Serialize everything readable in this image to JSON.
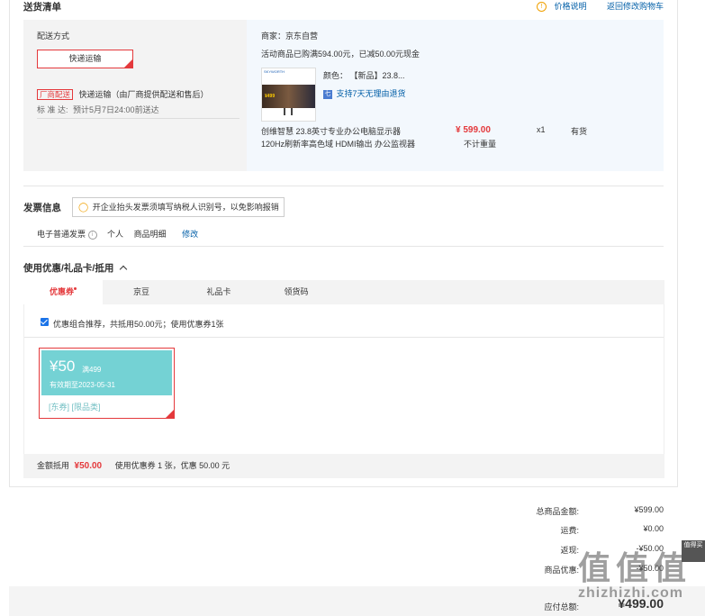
{
  "header": {
    "title": "送货清单",
    "price_note": "价格说明",
    "back_link": "返回修改购物车"
  },
  "shipping": {
    "label": "配送方式",
    "method_button": "快递运输",
    "tag": "厂商配送",
    "desc": "快递运输（由厂商提供配送和售后）",
    "std_label": "标 准 达:",
    "std_value": "预计5月7日24:00前送达"
  },
  "shop": {
    "seller": "商家：京东自营",
    "promo": "活动商品已购满594.00元，已减50.00元现金",
    "color_label": "颜色：",
    "color_value": "【新品】23.8...",
    "return_policy": "支持7天无理由退货",
    "product_name_1": "创维智慧 23.8英寸专业办公电脑显示器",
    "product_name_2": "120Hz刷新率高色域 HDMI输出 办公监视器",
    "price": "¥ 599.00",
    "weight": "不计重量",
    "qty": "x1",
    "stock": "有货",
    "thumb_brand": "SKYWORTH",
    "thumb_price": "¥499"
  },
  "invoice": {
    "title": "发票信息",
    "tip": "开企业抬头发票须填写纳税人识别号，以免影响报销",
    "type": "电子普通发票",
    "person": "个人",
    "detail": "商品明细",
    "edit": "修改"
  },
  "discount": {
    "title": "使用优惠/礼品卡/抵用",
    "tabs": [
      "优惠券",
      "京豆",
      "礼品卡",
      "领货码"
    ],
    "recommend": "优惠组合推荐，共抵用50.00元；使用优惠券1张",
    "coupon": {
      "amount": "¥50",
      "condition": "满499",
      "expiry": "有效期至2023-05-31",
      "tags": "[东券] [限品类]"
    },
    "footer_label": "金额抵用",
    "footer_amount": "¥50.00",
    "footer_desc": "使用优惠券 1 张，优惠 50.00 元"
  },
  "summary": {
    "total_label": "总商品金额:",
    "total_value": "¥599.00",
    "freight_label": "运费:",
    "freight_value": "¥0.00",
    "cashback_label": "返现:",
    "cashback_value": "-¥50.00",
    "promo_label": "商品优惠:",
    "promo_value": "-¥50.00",
    "pay_label": "应付总额:",
    "pay_value": "¥499.00"
  },
  "watermark": {
    "logo": "值",
    "site": "zhizhizhi.com",
    "side": "值得买"
  },
  "colors": {
    "accent": "#e4393c",
    "link": "#005ea7",
    "coupon": "#74d2d4"
  }
}
